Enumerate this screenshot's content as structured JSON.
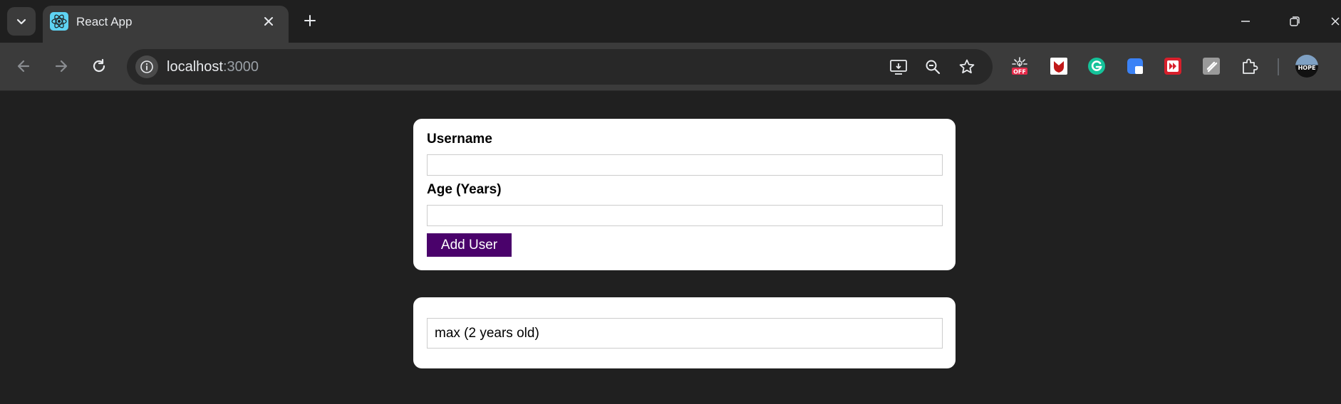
{
  "browser": {
    "tab": {
      "title": "React App",
      "favicon": "react-logo-icon"
    },
    "address": {
      "host": "localhost",
      "port": ":3000"
    },
    "extensions": [
      {
        "name": "off-extension-icon",
        "badge": "OFF"
      },
      {
        "name": "mcafee-extension-icon"
      },
      {
        "name": "grammarly-extension-icon"
      },
      {
        "name": "blue-square-extension-icon"
      },
      {
        "name": "red-play-extension-icon"
      },
      {
        "name": "gray-extension-icon"
      }
    ],
    "profile_badge": "HOPE"
  },
  "form": {
    "username_label": "Username",
    "username_value": "",
    "age_label": "Age (Years)",
    "age_value": "",
    "submit_label": "Add User"
  },
  "users": [
    {
      "text": "max (2 years old)"
    }
  ]
}
